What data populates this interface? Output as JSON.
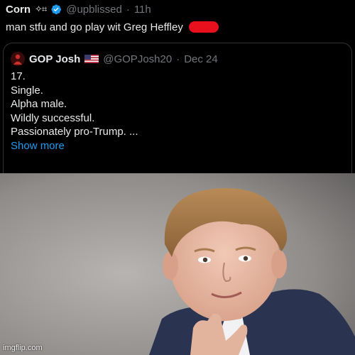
{
  "reply": {
    "display_name": "Corn",
    "name_decoration": "✧⌗",
    "handle": "@upblissed",
    "separator": "·",
    "time": "11h",
    "text": "man stfu and go play wit Greg Heffley",
    "verified_icon": "verified-badge-icon",
    "emoji_icon": "red-censored-emoji-icon",
    "verified_color": "#1d9bf0"
  },
  "quote": {
    "display_name": "GOP Josh",
    "handle": "@GOPJosh20",
    "separator": "·",
    "date": "Dec 24",
    "flag_icon": "us-flag-icon",
    "avatar_icon": "gop-avatar-icon",
    "lines": [
      "17.",
      "Single.",
      "Alpha male.",
      "Wildly successful.",
      "Passionately pro-Trump. ..."
    ],
    "show_more": "Show more",
    "link_color": "#1d9bf0"
  },
  "photo": {
    "subject": "portrait-photo",
    "watermark": "imgflip.com"
  }
}
